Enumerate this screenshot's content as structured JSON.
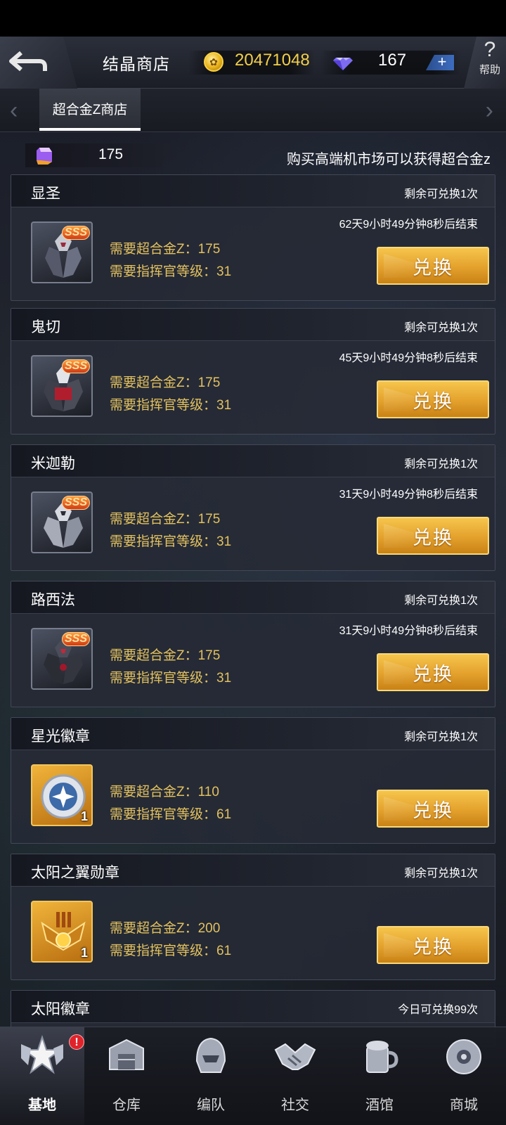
{
  "header": {
    "title": "结晶商店",
    "gold_amount": "20471048",
    "diamond_amount": "167",
    "add_symbol": "+",
    "help_label": "帮助"
  },
  "tabs": [
    {
      "label": "超合金Z商店",
      "active": true
    }
  ],
  "balance": {
    "alloy_amount": "175",
    "info": "购买高端机市场可以获得超合金z"
  },
  "items": [
    {
      "name": "显圣",
      "remaining": "剩余可兑换1次",
      "timer": "62天9小时49分钟8秒后结束",
      "cost": "需要超合金Z：175",
      "level": "需要指挥官等级：31",
      "button": "兑换",
      "badge": "SSS"
    },
    {
      "name": "鬼切",
      "remaining": "剩余可兑换1次",
      "timer": "45天9小时49分钟8秒后结束",
      "cost": "需要超合金Z：175",
      "level": "需要指挥官等级：31",
      "button": "兑换",
      "badge": "SSS"
    },
    {
      "name": "米迦勒",
      "remaining": "剩余可兑换1次",
      "timer": "31天9小时49分钟8秒后结束",
      "cost": "需要超合金Z：175",
      "level": "需要指挥官等级：31",
      "button": "兑换",
      "badge": "SSS"
    },
    {
      "name": "路西法",
      "remaining": "剩余可兑换1次",
      "timer": "31天9小时49分钟8秒后结束",
      "cost": "需要超合金Z：175",
      "level": "需要指挥官等级：31",
      "button": "兑换",
      "badge": "SSS"
    },
    {
      "name": "星光徽章",
      "remaining": "剩余可兑换1次",
      "timer": "",
      "cost": "需要超合金Z：110",
      "level": "需要指挥官等级：61",
      "button": "兑换",
      "count": "1"
    },
    {
      "name": "太阳之翼勋章",
      "remaining": "剩余可兑换1次",
      "timer": "",
      "cost": "需要超合金Z：200",
      "level": "需要指挥官等级：61",
      "button": "兑换",
      "count": "1"
    },
    {
      "name": "太阳徽章",
      "remaining": "今日可兑换99次"
    }
  ],
  "bottom_nav": [
    {
      "label": "基地",
      "icon": "base-star-icon",
      "badge": "!"
    },
    {
      "label": "仓库",
      "icon": "warehouse-icon"
    },
    {
      "label": "编队",
      "icon": "helmet-icon"
    },
    {
      "label": "社交",
      "icon": "handshake-icon"
    },
    {
      "label": "酒馆",
      "icon": "tavern-icon"
    },
    {
      "label": "商城",
      "icon": "shop-orb-icon"
    }
  ],
  "colors": {
    "gold_text": "#f3cf49",
    "requirement_text": "#e3c15f",
    "button_gold": "#e3a12c",
    "badge_red": "#e0232b"
  }
}
